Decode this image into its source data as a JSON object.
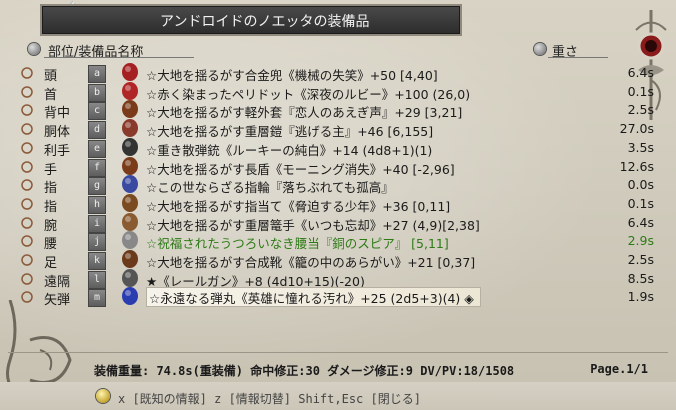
{
  "window": {
    "title": "アンドロイドのノエッタの装備品"
  },
  "header": {
    "left_label": "部位/装備品名称",
    "right_label": "重さ"
  },
  "rows": [
    {
      "slot": "頭",
      "key": "a",
      "item": "☆大地を揺るがす合金兜《機械の失笑》+50 [4,40]",
      "weight": "6.4s",
      "color": "normal",
      "icon": "helmet-icon"
    },
    {
      "slot": "首",
      "key": "b",
      "item": "☆赤く染まったペリドット《深夜のルビー》+100 (26,0)",
      "weight": "0.1s",
      "color": "normal",
      "icon": "amulet-icon"
    },
    {
      "slot": "背中",
      "key": "c",
      "item": "☆大地を揺るがす軽外套『恋人のあえぎ声』+29 [3,21]",
      "weight": "2.5s",
      "color": "normal",
      "icon": "cloak-icon"
    },
    {
      "slot": "胴体",
      "key": "d",
      "item": "☆大地を揺るがす重層鎧『逃げる主』+46 [6,155]",
      "weight": "27.0s",
      "color": "normal",
      "icon": "armor-icon"
    },
    {
      "slot": "利手",
      "key": "e",
      "item": "☆重き散弾銃《ルーキーの純白》+14 (4d8+1)(1)",
      "weight": "3.5s",
      "color": "normal",
      "icon": "shotgun-icon"
    },
    {
      "slot": "手",
      "key": "f",
      "item": "☆大地を揺るがす長盾《モーニング消失》+40 [-2,96]",
      "weight": "12.6s",
      "color": "normal",
      "icon": "shield-icon"
    },
    {
      "slot": "指",
      "key": "g",
      "item": "☆この世ならざる指輪『落ちぶれても孤高』",
      "weight": "0.0s",
      "color": "normal",
      "icon": "ring-icon"
    },
    {
      "slot": "指",
      "key": "h",
      "item": "☆大地を揺るがす指当て《脅迫する少年》+36 [0,11]",
      "weight": "0.1s",
      "color": "normal",
      "icon": "finger-guard-icon"
    },
    {
      "slot": "腕",
      "key": "i",
      "item": "☆大地を揺るがす重層篭手《いつも忘却》+27 (4,9)[2,38]",
      "weight": "6.4s",
      "color": "normal",
      "icon": "gauntlet-icon"
    },
    {
      "slot": "腰",
      "key": "j",
      "item": "☆祝福されたうつろいなき腰当『銅のスピア』 [5,11]",
      "weight": "2.9s",
      "color": "green",
      "icon": "belt-icon"
    },
    {
      "slot": "足",
      "key": "k",
      "item": "☆大地を揺るがす合成靴《籠の中のあらがい》+21 [0,37]",
      "weight": "2.5s",
      "color": "normal",
      "icon": "boots-icon"
    },
    {
      "slot": "遠隔",
      "key": "l",
      "item": "★《レールガン》+8 (4d10+15)(-20)",
      "weight": "8.5s",
      "color": "normal",
      "icon": "railgun-icon"
    },
    {
      "slot": "矢弾",
      "key": "m",
      "item": "☆永遠なる弾丸《英雄に憧れる汚れ》+25 (2d5+3)(4) ◈",
      "weight": "1.9s",
      "color": "normal",
      "icon": "bullet-icon"
    }
  ],
  "stats": "装備重量: 74.8s(重装備) 命中修正:30 ダメージ修正:9 DV/PV:18/1508",
  "page": "Page.1/1",
  "hint": "x [既知の情報] z [情報切替] Shift,Esc [閉じる]",
  "colors": {
    "green": "#2d7a16",
    "title_bg": "#2c2c2c"
  }
}
